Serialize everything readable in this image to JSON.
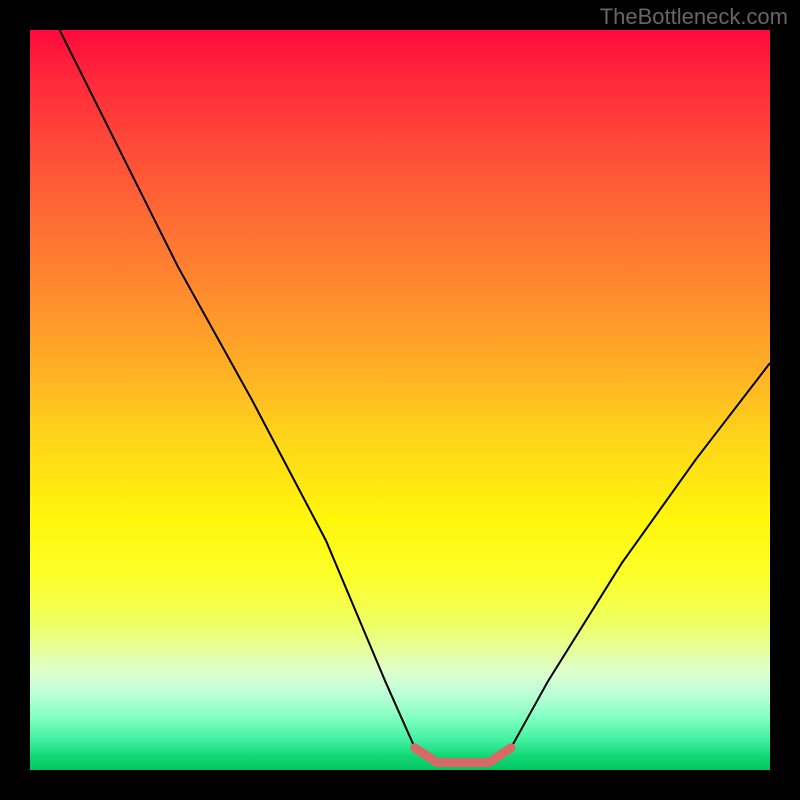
{
  "watermark": "TheBottleneck.com",
  "chart_data": {
    "type": "line",
    "title": "",
    "xlabel": "",
    "ylabel": "",
    "xlim": [
      0,
      100
    ],
    "ylim": [
      0,
      100
    ],
    "series": [
      {
        "name": "bottleneck-curve",
        "x": [
          4,
          10,
          20,
          30,
          40,
          48,
          52,
          55,
          58,
          62,
          65,
          70,
          80,
          90,
          100
        ],
        "y": [
          100,
          88,
          68,
          50,
          31,
          12,
          3,
          1,
          1,
          1,
          3,
          12,
          28,
          42,
          55
        ]
      },
      {
        "name": "highlight-band",
        "x": [
          52,
          55,
          58,
          62,
          65
        ],
        "y": [
          3,
          1,
          1,
          1,
          3
        ]
      }
    ],
    "colors": {
      "curve": "#000000",
      "highlight": "#d86a66",
      "gradient_top": "#ff0a3c",
      "gradient_mid": "#fff60a",
      "gradient_bottom": "#00c860"
    }
  }
}
